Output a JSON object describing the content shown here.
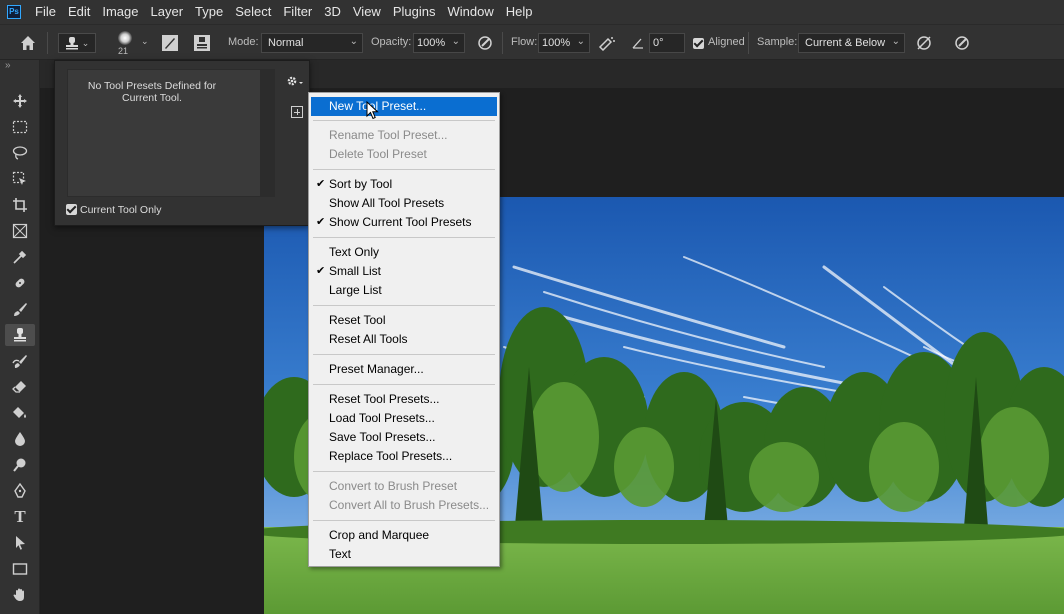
{
  "app": {
    "logo": "Ps"
  },
  "menubar": {
    "items": [
      "File",
      "Edit",
      "Image",
      "Layer",
      "Type",
      "Select",
      "Filter",
      "3D",
      "View",
      "Plugins",
      "Window",
      "Help"
    ]
  },
  "options": {
    "brush_size": "21",
    "mode_label": "Mode:",
    "mode_value": "Normal",
    "opacity_label": "Opacity:",
    "opacity_value": "100%",
    "flow_label": "Flow:",
    "flow_value": "100%",
    "angle_value": "0°",
    "aligned_label": "Aligned",
    "sample_label": "Sample:",
    "sample_value": "Current & Below"
  },
  "preset_panel": {
    "empty_message": "No Tool Presets Defined for Current Tool.",
    "current_tool_only_label": "Current Tool Only"
  },
  "menu": {
    "new_tool_preset": "New Tool Preset...",
    "rename_tool_preset": "Rename Tool Preset...",
    "delete_tool_preset": "Delete Tool Preset",
    "sort_by_tool": "Sort by Tool",
    "show_all_tool_presets": "Show All Tool Presets",
    "show_current_tool_presets": "Show Current Tool Presets",
    "text_only": "Text Only",
    "small_list": "Small List",
    "large_list": "Large List",
    "reset_tool": "Reset Tool",
    "reset_all_tools": "Reset All Tools",
    "preset_manager": "Preset Manager...",
    "reset_tool_presets": "Reset Tool Presets...",
    "load_tool_presets": "Load Tool Presets...",
    "save_tool_presets": "Save Tool Presets...",
    "replace_tool_presets": "Replace Tool Presets...",
    "convert_to_brush_preset": "Convert to Brush Preset",
    "convert_all_to_brush_presets": "Convert All to Brush Presets...",
    "crop_and_marquee": "Crop and Marquee",
    "text": "Text"
  },
  "colors": {
    "highlight": "#0a6ed1",
    "sky_top": "#1d5fb8",
    "foliage": "#3b7a22",
    "grass": "#6aa640"
  }
}
